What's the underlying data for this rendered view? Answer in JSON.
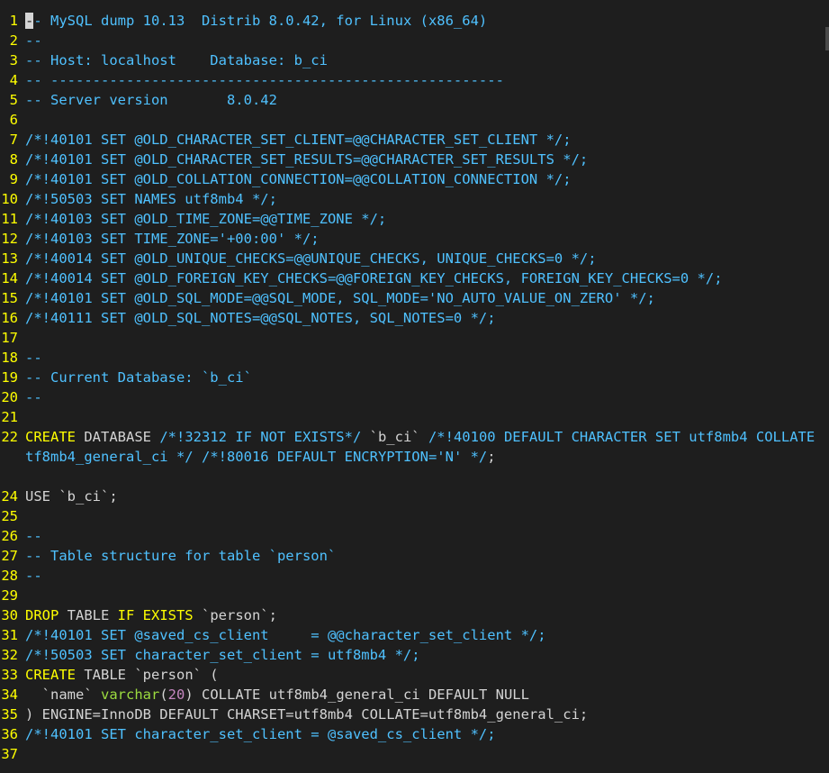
{
  "editor": {
    "lines": [
      {
        "n": "1",
        "segs": [
          {
            "t": "-",
            "c": "cm cursor"
          },
          {
            "t": "- MySQL dump 10.13  Distrib 8.0.42, for Linux (x86_64)",
            "c": "cm"
          }
        ]
      },
      {
        "n": "2",
        "segs": [
          {
            "t": "--",
            "c": "cm"
          }
        ]
      },
      {
        "n": "3",
        "segs": [
          {
            "t": "-- Host: localhost    Database: b_ci",
            "c": "cm"
          }
        ]
      },
      {
        "n": "4",
        "segs": [
          {
            "t": "-- ------------------------------------------------------",
            "c": "cm"
          }
        ]
      },
      {
        "n": "5",
        "segs": [
          {
            "t": "-- Server version\t8.0.42",
            "c": "cm"
          }
        ]
      },
      {
        "n": "6",
        "segs": []
      },
      {
        "n": "7",
        "segs": [
          {
            "t": "/*!40101 SET @OLD_CHARACTER_SET_CLIENT=@@CHARACTER_SET_CLIENT */;",
            "c": "cm"
          }
        ]
      },
      {
        "n": "8",
        "segs": [
          {
            "t": "/*!40101 SET @OLD_CHARACTER_SET_RESULTS=@@CHARACTER_SET_RESULTS */;",
            "c": "cm"
          }
        ]
      },
      {
        "n": "9",
        "segs": [
          {
            "t": "/*!40101 SET @OLD_COLLATION_CONNECTION=@@COLLATION_CONNECTION */;",
            "c": "cm"
          }
        ]
      },
      {
        "n": "10",
        "segs": [
          {
            "t": "/*!50503 SET NAMES utf8mb4 */;",
            "c": "cm"
          }
        ]
      },
      {
        "n": "11",
        "segs": [
          {
            "t": "/*!40103 SET @OLD_TIME_ZONE=@@TIME_ZONE */;",
            "c": "cm"
          }
        ]
      },
      {
        "n": "12",
        "segs": [
          {
            "t": "/*!40103 SET TIME_ZONE='+00:00' */;",
            "c": "cm"
          }
        ]
      },
      {
        "n": "13",
        "segs": [
          {
            "t": "/*!40014 SET @OLD_UNIQUE_CHECKS=@@UNIQUE_CHECKS, UNIQUE_CHECKS=0 */;",
            "c": "cm"
          }
        ]
      },
      {
        "n": "14",
        "segs": [
          {
            "t": "/*!40014 SET @OLD_FOREIGN_KEY_CHECKS=@@FOREIGN_KEY_CHECKS, FOREIGN_KEY_CHECKS=0 */;",
            "c": "cm"
          }
        ]
      },
      {
        "n": "15",
        "segs": [
          {
            "t": "/*!40101 SET @OLD_SQL_MODE=@@SQL_MODE, SQL_MODE='NO_AUTO_VALUE_ON_ZERO' */;",
            "c": "cm"
          }
        ]
      },
      {
        "n": "16",
        "segs": [
          {
            "t": "/*!40111 SET @OLD_SQL_NOTES=@@SQL_NOTES, SQL_NOTES=0 */;",
            "c": "cm"
          }
        ]
      },
      {
        "n": "17",
        "segs": []
      },
      {
        "n": "18",
        "segs": [
          {
            "t": "--",
            "c": "cm"
          }
        ]
      },
      {
        "n": "19",
        "segs": [
          {
            "t": "-- Current Database: `b_ci`",
            "c": "cm"
          }
        ]
      },
      {
        "n": "20",
        "segs": [
          {
            "t": "--",
            "c": "cm"
          }
        ]
      },
      {
        "n": "21",
        "segs": []
      },
      {
        "n": "22",
        "segs": [
          {
            "t": "CREATE",
            "c": "kw"
          },
          {
            "t": " DATABASE ",
            "c": "tx"
          },
          {
            "t": "/*!32312 IF NOT EXISTS*/",
            "c": "cm"
          },
          {
            "t": " `b_ci` ",
            "c": "tx"
          },
          {
            "t": "/*!40100 DEFAULT CHARACTER SET utf8mb4 COLLATE u",
            "c": "cm"
          }
        ]
      },
      {
        "n": "",
        "segs": [
          {
            "t": "tf8mb4_general_ci */",
            "c": "cm"
          },
          {
            "t": " ",
            "c": "tx"
          },
          {
            "t": "/*!80016 DEFAULT ENCRYPTION='N' */",
            "c": "cm"
          },
          {
            "t": ";",
            "c": "tx"
          }
        ]
      },
      {
        "n": "",
        "segs": []
      },
      {
        "n": "24",
        "segs": [
          {
            "t": "USE `b_ci`;",
            "c": "tx"
          }
        ]
      },
      {
        "n": "25",
        "segs": []
      },
      {
        "n": "26",
        "segs": [
          {
            "t": "--",
            "c": "cm"
          }
        ]
      },
      {
        "n": "27",
        "segs": [
          {
            "t": "-- Table structure for table `person`",
            "c": "cm"
          }
        ]
      },
      {
        "n": "28",
        "segs": [
          {
            "t": "--",
            "c": "cm"
          }
        ]
      },
      {
        "n": "29",
        "segs": []
      },
      {
        "n": "30",
        "segs": [
          {
            "t": "DROP",
            "c": "kw"
          },
          {
            "t": " TABLE ",
            "c": "tx"
          },
          {
            "t": "IF EXISTS",
            "c": "kw"
          },
          {
            "t": " `person`;",
            "c": "tx"
          }
        ]
      },
      {
        "n": "31",
        "segs": [
          {
            "t": "/*!40101 SET @saved_cs_client     = @@character_set_client */;",
            "c": "cm"
          }
        ]
      },
      {
        "n": "32",
        "segs": [
          {
            "t": "/*!50503 SET character_set_client = utf8mb4 */;",
            "c": "cm"
          }
        ]
      },
      {
        "n": "33",
        "segs": [
          {
            "t": "CREATE",
            "c": "kw"
          },
          {
            "t": " TABLE `person` (",
            "c": "tx"
          }
        ]
      },
      {
        "n": "34",
        "segs": [
          {
            "t": "  `name` ",
            "c": "tx"
          },
          {
            "t": "varchar",
            "c": "fn"
          },
          {
            "t": "(",
            "c": "tx"
          },
          {
            "t": "20",
            "c": "num"
          },
          {
            "t": ") COLLATE utf8mb4_general_ci DEFAULT NULL",
            "c": "tx"
          }
        ]
      },
      {
        "n": "35",
        "segs": [
          {
            "t": ") ENGINE=InnoDB DEFAULT CHARSET=utf8mb4 COLLATE=utf8mb4_general_ci;",
            "c": "tx"
          }
        ]
      },
      {
        "n": "36",
        "segs": [
          {
            "t": "/*!40101 SET character_set_client = @saved_cs_client */;",
            "c": "cm"
          }
        ]
      },
      {
        "n": "37",
        "segs": []
      }
    ]
  },
  "colors": {
    "background": "#1e1e1e",
    "line_number": "#ffff00",
    "comment": "#4fc1ff",
    "keyword": "#ffff00",
    "text": "#d4d4d4",
    "function": "#9cdc3f",
    "number": "#c586c0"
  }
}
